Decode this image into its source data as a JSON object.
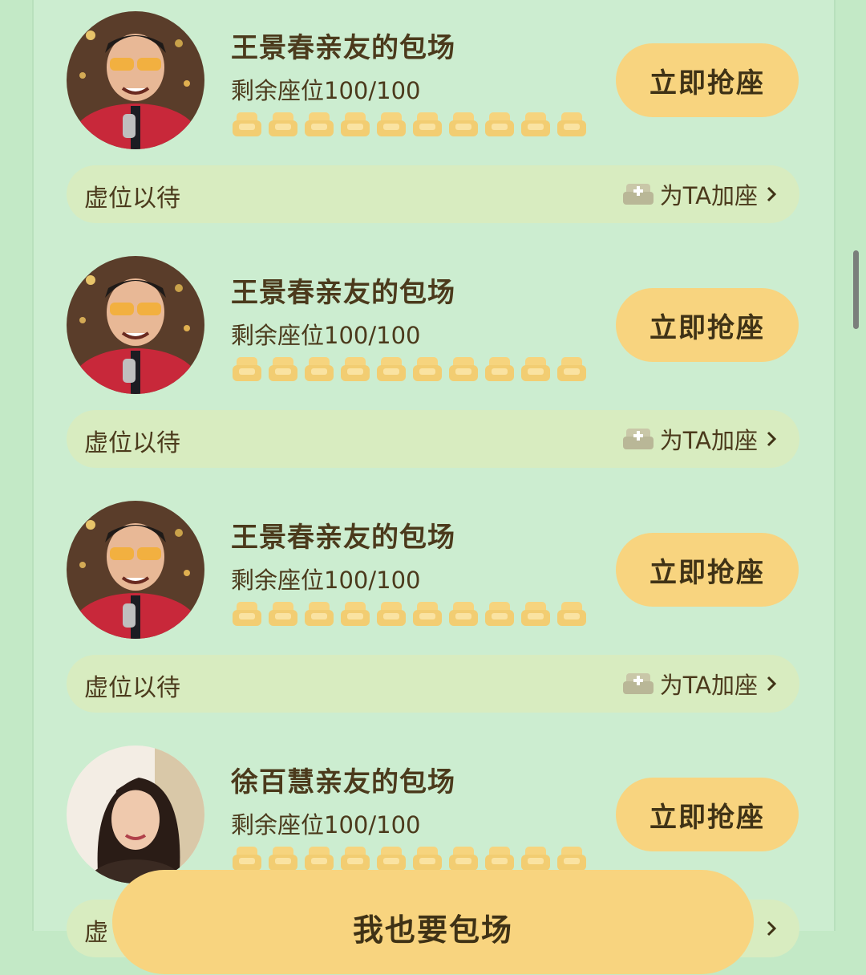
{
  "sessions": [
    {
      "title": "王景春亲友的包场",
      "remaining": "剩余座位100/100",
      "button": "立即抢座",
      "status": "虚位以待",
      "add_seat": "为TA加座"
    },
    {
      "title": "王景春亲友的包场",
      "remaining": "剩余座位100/100",
      "button": "立即抢座",
      "status": "虚位以待",
      "add_seat": "为TA加座"
    },
    {
      "title": "王景春亲友的包场",
      "remaining": "剩余座位100/100",
      "button": "立即抢座",
      "status": "虚位以待",
      "add_seat": "为TA加座"
    },
    {
      "title": "徐百慧亲友的包场",
      "remaining": "剩余座位100/100",
      "button": "立即抢座",
      "status": "虚",
      "add_seat": ""
    }
  ],
  "seat_icons_per_row": 10,
  "bottom_button": {
    "label": "我也要包场"
  },
  "colors": {
    "background": "#ccedd0",
    "accent": "#f8d47f",
    "text": "#4b3a1c",
    "bar": "#d8ecc0"
  },
  "icons": {
    "seat": "sofa-icon",
    "add_seat": "sofa-plus-icon",
    "chevron": "chevron-right-icon"
  }
}
